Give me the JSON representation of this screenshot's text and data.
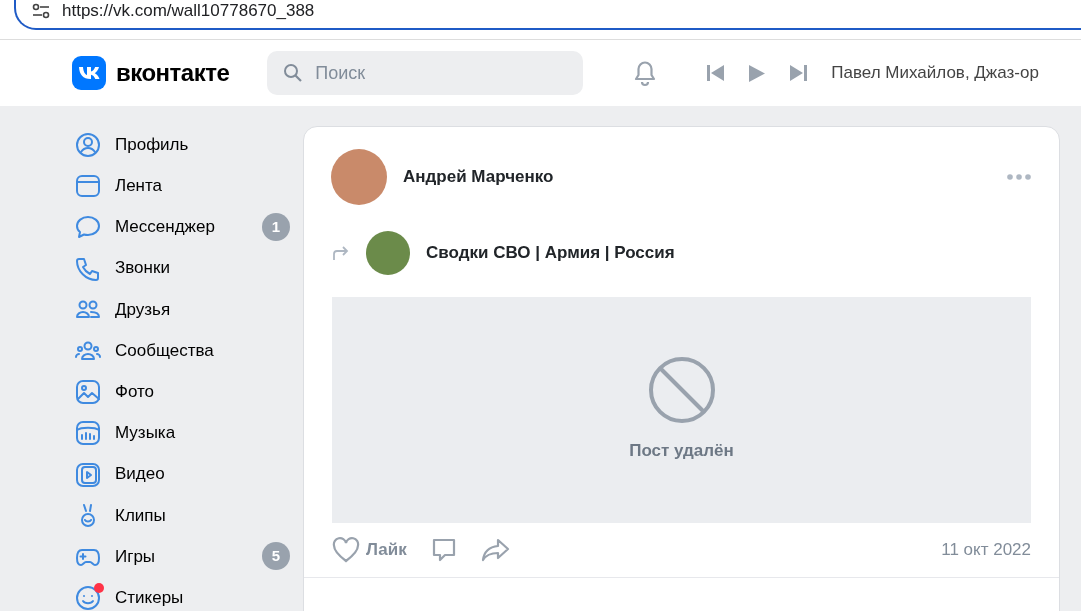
{
  "browser": {
    "url": "https://vk.com/wall10778670_388"
  },
  "header": {
    "logo_text": "вконтакте",
    "search": {
      "placeholder": "Поиск"
    },
    "now_playing": "Павел Михайлов, Джаз-ор"
  },
  "sidebar": {
    "items": [
      {
        "label": "Профиль"
      },
      {
        "label": "Лента"
      },
      {
        "label": "Мессенджер",
        "badge": "1"
      },
      {
        "label": "Звонки"
      },
      {
        "label": "Друзья"
      },
      {
        "label": "Сообщества"
      },
      {
        "label": "Фото"
      },
      {
        "label": "Музыка"
      },
      {
        "label": "Видео"
      },
      {
        "label": "Клипы"
      },
      {
        "label": "Игры",
        "badge": "5"
      },
      {
        "label": "Стикеры",
        "notification": true
      }
    ]
  },
  "post": {
    "author": "Андрей Марченко",
    "repost_source": "Сводки СВО | Армия | Россия",
    "deleted_text": "Пост удалён",
    "like_label": "Лайк",
    "date": "11 окт 2022"
  }
}
